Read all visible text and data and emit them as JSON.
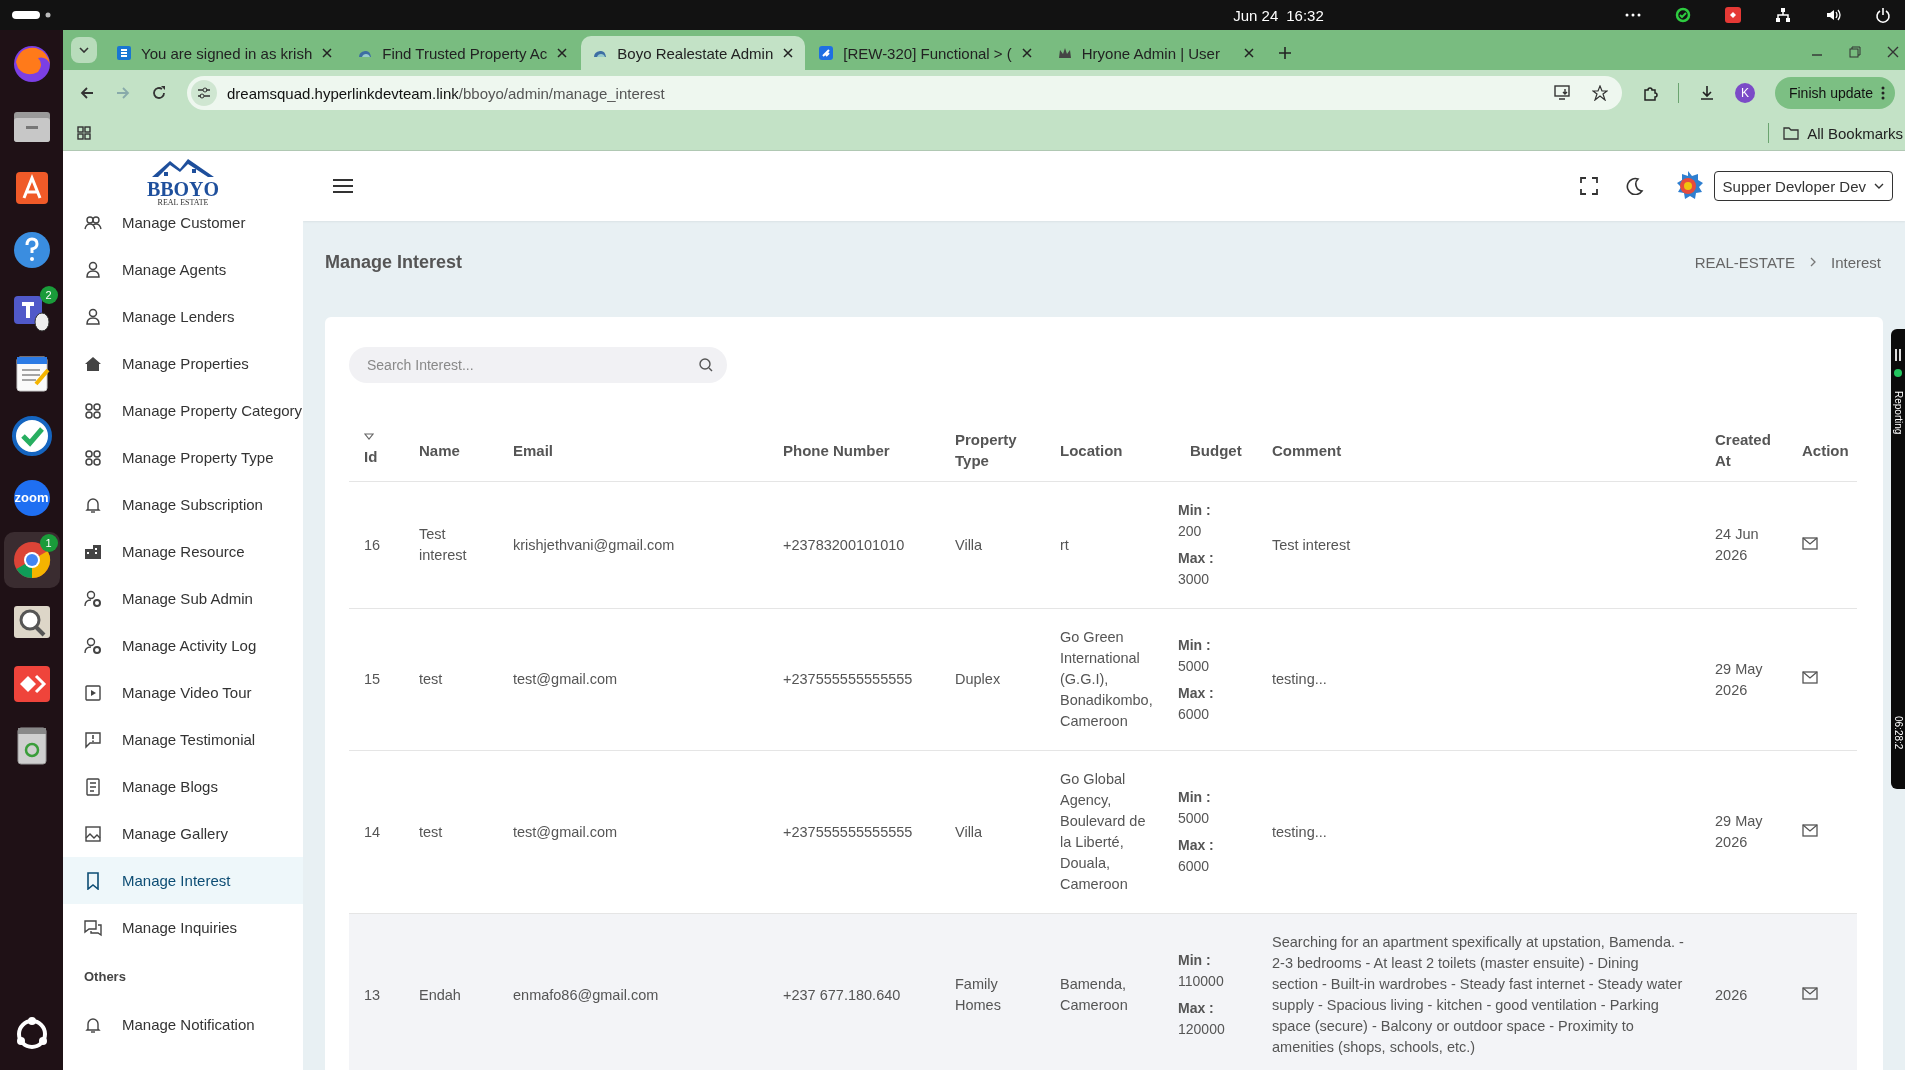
{
  "os_bar": {
    "date": "Jun 24",
    "time": "16:32"
  },
  "dock": {
    "items": [
      {
        "kind": "firefox"
      },
      {
        "kind": "files"
      },
      {
        "kind": "store"
      },
      {
        "kind": "help"
      },
      {
        "kind": "teams",
        "badge": "2"
      },
      {
        "kind": "editor"
      },
      {
        "kind": "check"
      },
      {
        "kind": "zoom",
        "label": "zoom"
      },
      {
        "kind": "chrome",
        "badge": "1",
        "selected": true
      },
      {
        "kind": "magnifier"
      },
      {
        "kind": "remote"
      },
      {
        "kind": "trash"
      },
      {
        "kind": "apps"
      }
    ]
  },
  "browser": {
    "tabs": [
      {
        "title": "You are signed in as krish",
        "kind": "s",
        "selected": false
      },
      {
        "title": "Find Trusted Property Ac",
        "kind": "cloud",
        "selected": false
      },
      {
        "title": "Boyo Realestate Admin",
        "kind": "cloud",
        "selected": true
      },
      {
        "title": "[REW-320] Functional > (",
        "kind": "jira",
        "selected": false
      },
      {
        "title": "Hryone Admin | User",
        "kind": "crown",
        "selected": false
      }
    ],
    "url_host": "dreamsquad.hyperlinkdevteam.link",
    "url_path": "/bboyo/admin/manage_interest",
    "profile_initial": "K",
    "update_button": "Finish update",
    "bookmarks": "All Bookmarks"
  },
  "app": {
    "logo": {
      "name": "BBOYO",
      "tagline": "REAL ESTATE"
    },
    "sidebar": {
      "groups": [
        {
          "items": [
            {
              "label": "Manage Customer",
              "kind": "users",
              "selected": false
            },
            {
              "label": "Manage Agents",
              "kind": "user",
              "selected": false
            },
            {
              "label": "Manage Lenders",
              "kind": "user",
              "selected": false
            },
            {
              "label": "Manage Properties",
              "kind": "home",
              "selected": false
            },
            {
              "label": "Manage Property Category",
              "kind": "grid",
              "selected": false
            },
            {
              "label": "Manage Property Type",
              "kind": "grid",
              "selected": false
            },
            {
              "label": "Manage Subscription",
              "kind": "bell",
              "selected": false
            },
            {
              "label": "Manage Resource",
              "kind": "building",
              "selected": false
            },
            {
              "label": "Manage Sub Admin",
              "kind": "usergear",
              "selected": false
            },
            {
              "label": "Manage Activity Log",
              "kind": "usergear",
              "selected": false
            },
            {
              "label": "Manage Video Tour",
              "kind": "video",
              "selected": false
            },
            {
              "label": "Manage Testimonial",
              "kind": "feedback",
              "selected": false
            },
            {
              "label": "Manage Blogs",
              "kind": "doc",
              "selected": false
            },
            {
              "label": "Manage Gallery",
              "kind": "gallery",
              "selected": false
            },
            {
              "label": "Manage Interest",
              "kind": "bookmark",
              "selected": true
            },
            {
              "label": "Manage Inquiries",
              "kind": "chat",
              "selected": false
            }
          ]
        },
        {
          "heading": "Others",
          "items": [
            {
              "label": "Manage Notification",
              "kind": "bell",
              "selected": false
            }
          ]
        }
      ]
    },
    "header": {
      "user": "Supper Devloper Dev"
    },
    "page": {
      "title": "Manage Interest",
      "breadcrumb": [
        "REAL-ESTATE",
        "Interest"
      ]
    },
    "search": {
      "placeholder": "Search Interest..."
    },
    "table": {
      "columns": [
        "Id",
        "Name",
        "Email",
        "Phone Number",
        "Property Type",
        "Location",
        "Budget",
        "Comment",
        "Created At",
        "Action"
      ],
      "rows": [
        {
          "id": "16",
          "name": "Test interest",
          "email": "krishjethvani@gmail.com",
          "phone": "+23783200101010",
          "property_type": "Villa",
          "location": "rt",
          "budget": [
            {
              "label": "Min :",
              "value": "200"
            },
            {
              "label": "Max :",
              "value": "3000"
            }
          ],
          "comment": "Test interest",
          "created_at": "24 Jun 2026",
          "highlighted": false
        },
        {
          "id": "15",
          "name": "test",
          "email": "test@gmail.com",
          "phone": "+237555555555555",
          "property_type": "Duplex",
          "location": "Go Green International (G.G.I), Bonadikombo, Cameroon",
          "budget": [
            {
              "label": "Min :",
              "value": "5000"
            },
            {
              "label": "Max :",
              "value": "6000"
            }
          ],
          "comment": "testing...",
          "created_at": "29 May 2026",
          "highlighted": false
        },
        {
          "id": "14",
          "name": "test",
          "email": "test@gmail.com",
          "phone": "+237555555555555",
          "property_type": "Villa",
          "location": "Go Global Agency, Boulevard de la Liberté, Douala, Cameroon",
          "budget": [
            {
              "label": "Min :",
              "value": "5000"
            },
            {
              "label": "Max :",
              "value": "6000"
            }
          ],
          "comment": "testing...",
          "created_at": "29 May 2026",
          "highlighted": false
        },
        {
          "id": "13",
          "name": "Endah",
          "email": "enmafo86@gmail.com",
          "phone": "+237 677.180.640",
          "property_type": "Family Homes",
          "location": "Bamenda, Cameroon",
          "budget": [
            {
              "label": "Min :",
              "value": "110000"
            },
            {
              "label": "Max :",
              "value": "120000"
            }
          ],
          "comment": "Searching for an apartment spexifically at upstation, Bamenda. - 2-3 bedrooms - At least 2 toilets (master ensuite) - Dining section - Built-in wardrobes - Steady fast internet - Steady water supply - Spacious living - kitchen - good ventilation - Parking space (secure) - Balcony or outdoor space - Proximity to amenities (shops, schools, etc.)",
          "created_at": "2026",
          "highlighted": true
        }
      ]
    }
  },
  "recorder": {
    "label": "Reporting",
    "timer": "06:28:2"
  }
}
